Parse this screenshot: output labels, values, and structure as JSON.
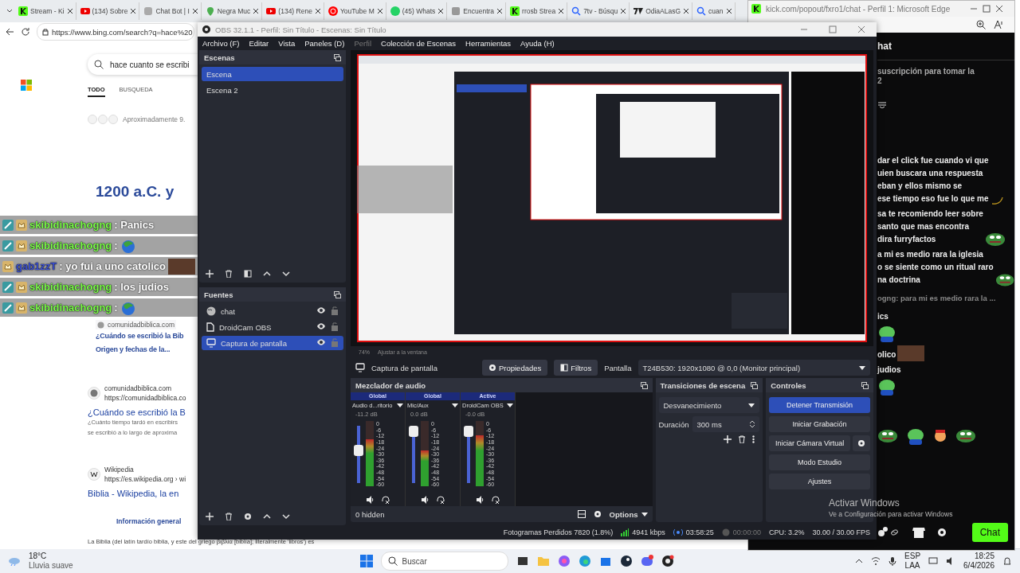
{
  "browser": {
    "tabs": [
      {
        "label": "Stream - Ki",
        "kind": "kick"
      },
      {
        "label": "(134) Sobre",
        "kind": "youtube"
      },
      {
        "label": "Chat Bot | I",
        "kind": "bot"
      },
      {
        "label": "Negra Muc",
        "kind": "map"
      },
      {
        "label": "(134) Rene",
        "kind": "youtube"
      },
      {
        "label": "YouTube M",
        "kind": "music"
      },
      {
        "label": "(45) Whats",
        "kind": "whatsapp"
      },
      {
        "label": "Encuentra",
        "kind": "page"
      },
      {
        "label": "rrosb Strea",
        "kind": "kick"
      },
      {
        "label": "7tv - Búsqu",
        "kind": "search"
      },
      {
        "label": "OdiaALasG",
        "kind": "seventv"
      },
      {
        "label": "cuan",
        "kind": "search"
      }
    ],
    "address": "https://www.bing.com/search?q=hace%20",
    "search_query": "hace cuanto se escribi",
    "nav_tabs": [
      {
        "label": "TODO",
        "selected": true
      },
      {
        "label": "BUSQUEDA",
        "selected": false
      }
    ],
    "result_count": "Aproximadamente 9.",
    "answer_title": "1200 a.C. y",
    "card": {
      "source": "comunidadbiblica.com",
      "title_lines": [
        "¿Cuándo se escribió la Bib",
        "Origen y fechas de la..."
      ]
    },
    "results": [
      {
        "site": "comunidadbiblica.com",
        "url": "https://comunidadbiblica.co",
        "kind": "globe",
        "title": "¿Cuándo se escribió la B",
        "snippet": [
          "¿Cuánto tiempo tardó en escribirs",
          "se escribió a lo largo de aproxima"
        ]
      },
      {
        "site": "Wikipedia",
        "url": "https://es.wikipedia.org › wi",
        "kind": "wiki",
        "title": "Biblia - Wikipedia, la en"
      }
    ],
    "info_tab": "Información general",
    "snippet": "La Biblia (del latín tardío biblia, y este del griego βιβλία [biblía]; literalmente 'libros') es"
  },
  "chat_overlay": [
    {
      "badges": [
        {
          "kind": "mod"
        },
        {
          "kind": "sub"
        }
      ],
      "user": "skibidinachogng",
      "color": "#7cfc4a",
      "text": ": Panics"
    },
    {
      "badges": [
        {
          "kind": "mod"
        },
        {
          "kind": "sub"
        }
      ],
      "user": "skibidinachogng",
      "color": "#7cfc4a",
      "text": ":",
      "emote": {
        "kind": "globe"
      }
    },
    {
      "badges": [
        {
          "kind": "sub"
        }
      ],
      "user": "gab1zzT",
      "color": "#3a4fd0",
      "text": ": yo fui a uno catolico",
      "emote": {
        "kind": "photo"
      }
    },
    {
      "badges": [
        {
          "kind": "mod"
        },
        {
          "kind": "sub"
        }
      ],
      "user": "skibidinachogng",
      "color": "#7cfc4a",
      "text": ": los judios"
    },
    {
      "badges": [
        {
          "kind": "mod"
        },
        {
          "kind": "sub"
        }
      ],
      "user": "skibidinachogng",
      "color": "#7cfc4a",
      "text": ":",
      "emote": {
        "kind": "globe"
      }
    }
  ],
  "kick_chat": {
    "window_title": "kick.com/popout/fxro1/chat - Perfil 1: Microsoft Edge",
    "header": "hat",
    "pinned": [
      "suscripción para tomar la",
      "2"
    ],
    "messages": [
      {
        "kind": "message",
        "lines": [
          "dar el click fue cuando vi que",
          "uien buscara una respuesta",
          "eban y ellos mismo se",
          "ese tiempo eso fue lo que me"
        ],
        "emote": {
          "kind": "banana"
        }
      },
      {
        "kind": "message",
        "lines": [
          "sa te recomiendo leer sobre",
          "santo que mas encontra",
          "dira furryfactos"
        ],
        "emote": {
          "kind": "pepe"
        }
      },
      {
        "kind": "message",
        "lines": [
          "a mi es medio rara la iglesia",
          "o se siente como un ritual raro",
          "na doctrina"
        ],
        "emote": {
          "kind": "pepe"
        }
      },
      {
        "kind": "reply",
        "lines": [
          "ogng: para mi es medio rara la ..."
        ]
      },
      {
        "kind": "message",
        "lines": [
          "ics"
        ]
      },
      {
        "kind": "message",
        "emote": {
          "kind": "frog"
        }
      },
      {
        "kind": "message",
        "lines": [
          "olico"
        ],
        "emote": {
          "kind": "photo"
        }
      },
      {
        "kind": "message",
        "lines": [
          "judios"
        ]
      },
      {
        "kind": "message",
        "emote": {
          "kind": "frog"
        }
      }
    ],
    "chat_button": "Chat"
  },
  "obs": {
    "title": "OBS 32.1.1 - Perfil: Sin Título - Escenas: Sin Título",
    "menu": [
      {
        "label": "Archivo (F)",
        "disabled": false
      },
      {
        "label": "Editar",
        "disabled": false
      },
      {
        "label": "Vista",
        "disabled": false
      },
      {
        "label": "Paneles (D)",
        "disabled": false
      },
      {
        "label": "Perfil",
        "disabled": true
      },
      {
        "label": "Colección de Escenas",
        "disabled": false
      },
      {
        "label": "Herramientas",
        "disabled": false
      },
      {
        "label": "Ayuda (H)",
        "disabled": false
      }
    ],
    "scenes": {
      "title": "Escenas",
      "items": [
        {
          "label": "Escena",
          "selected": true
        },
        {
          "label": "Escena 2",
          "selected": false
        }
      ]
    },
    "sources": {
      "title": "Fuentes",
      "items": [
        {
          "label": "chat",
          "kind": "browser",
          "selected": false,
          "visible": true,
          "locked": false
        },
        {
          "label": "DroidCam OBS",
          "kind": "media",
          "selected": false,
          "visible": true,
          "locked": false
        },
        {
          "label": "Captura de pantalla",
          "kind": "display",
          "selected": true,
          "visible": true,
          "locked": false
        }
      ]
    },
    "zoom": "74%",
    "fit": "Ajustar a la ventana",
    "source_bar": {
      "name": "Captura de pantalla",
      "properties": "Propiedades",
      "filters": "Filtros",
      "display_label": "Pantalla",
      "display": "T24B530: 1920x1080 @ 0,0 (Monitor principal)"
    },
    "mixer": {
      "title": "Mezclador de audio",
      "channels": [
        {
          "mode": "Global",
          "name": "Audio d...ritorio",
          "db": "-11.2 dB",
          "fader": {
            "level": 0.58
          },
          "meter": {
            "level": 0.72
          },
          "scale": [
            "0",
            "-6",
            "-12",
            "-18",
            "-24",
            "-30",
            "-36",
            "-42",
            "-48",
            "-54",
            "-60"
          ]
        },
        {
          "mode": "Global",
          "name": "Mic/Aux",
          "db": "0.0 dB",
          "fader": {
            "level": 1
          },
          "meter": {
            "level": 0.55
          },
          "scale": [
            "0",
            "-6",
            "-12",
            "-18",
            "-24",
            "-30",
            "-36",
            "-42",
            "-48",
            "-54",
            "-60"
          ]
        },
        {
          "mode": "Active",
          "name": "DroidCam OBS",
          "db": "-0.0 dB",
          "fader": {
            "level": 1
          },
          "meter": {
            "level": 0.78
          },
          "scale": [
            "0",
            "-6",
            "-12",
            "-18",
            "-24",
            "-30",
            "-36",
            "-42",
            "-48",
            "-54",
            "-60"
          ]
        }
      ],
      "hidden": "0 hidden",
      "options": "Options"
    },
    "transitions": {
      "title": "Transiciones de escena",
      "type": "Desvanecimiento",
      "duration_label": "Duración",
      "duration": "300 ms"
    },
    "controls": {
      "title": "Controles",
      "buttons": [
        {
          "label": "Detener Transmisión",
          "active": true,
          "gear": false
        },
        {
          "label": "Iniciar Grabación",
          "active": false,
          "gear": false
        },
        {
          "label": "Iniciar Cámara Virtual",
          "active": false,
          "gear": true
        },
        {
          "label": "Modo Estudio",
          "active": false,
          "gear": false
        },
        {
          "label": "Ajustes",
          "active": false,
          "gear": false
        }
      ]
    },
    "status": {
      "dropped": "Fotogramas Perdidos 7820 (1.8%)",
      "bitrate": "4941 kbps",
      "stream_time": "03:58:25",
      "record_time": "00:00:00",
      "cpu": "CPU: 3.2%",
      "fps": "30.00 / 30.00 FPS"
    }
  },
  "activation": {
    "title": "Activar Windows",
    "subtitle": "Ve a Configuración para activar Windows"
  },
  "taskbar": {
    "temperature": "18°C",
    "weather": "Lluvia suave",
    "search": "Buscar",
    "apps": [
      {
        "kind": "taskview"
      },
      {
        "kind": "folder"
      },
      {
        "kind": "copilot"
      },
      {
        "kind": "edge"
      },
      {
        "kind": "store"
      },
      {
        "kind": "steam"
      },
      {
        "kind": "discord"
      },
      {
        "kind": "obs"
      }
    ],
    "language": "ESP",
    "layout": "LAA",
    "time": "18:25",
    "date": "6/4/2026"
  }
}
